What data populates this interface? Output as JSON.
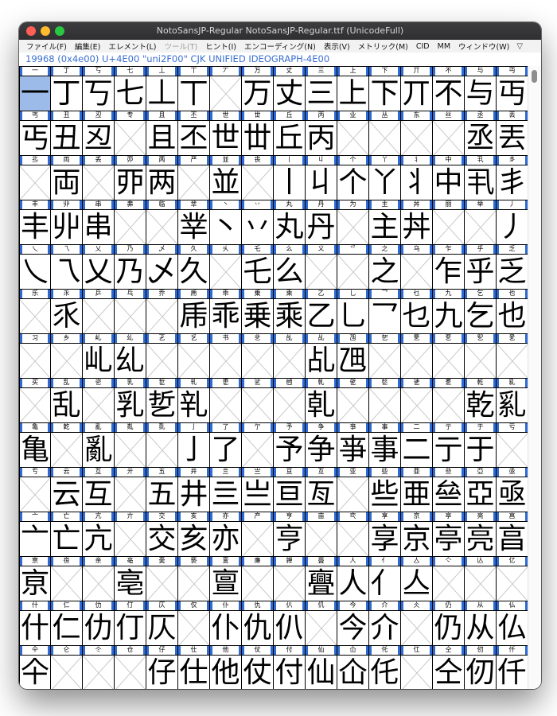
{
  "window": {
    "title": "NotoSansJP-Regular  NotoSansJP-Regular.ttf (UnicodeFull)"
  },
  "menu": [
    {
      "label": "ファイル(F)",
      "disabled": false
    },
    {
      "label": "編集(E)",
      "disabled": false
    },
    {
      "label": "エレメント(L)",
      "disabled": false
    },
    {
      "label": "ツール(T)",
      "disabled": true
    },
    {
      "label": "ヒント(I)",
      "disabled": false
    },
    {
      "label": "エンコーディング(N)",
      "disabled": false
    },
    {
      "label": "表示(V)",
      "disabled": false
    },
    {
      "label": "メトリック(M)",
      "disabled": false
    },
    {
      "label": "CID",
      "disabled": false
    },
    {
      "label": "MM",
      "disabled": false
    },
    {
      "label": "ウィンドウ(W)",
      "disabled": false
    }
  ],
  "menu_arrow": "▽",
  "info": {
    "text": "19968 (0x4e00) U+4E00 \"uni2F00\" CJK UNIFIED IDEOGRAPH-4E00"
  },
  "colors": {
    "selection": "#9cbbe8",
    "label_accent": "#2e6ad1",
    "info_text": "#3b6fd1"
  },
  "selected_index": 0,
  "rows": [
    {
      "labels": "一丁丂七丄丅丆万丈三上下丌不与丏",
      "glyphs": "一丁丂七丄丅　万丈三上下丌不与丏"
    },
    {
      "labels": "丐丑丒专且丕世丗丘丙业丛东丝丞丟",
      "glyphs": "丐丑丒　且丕世丗丘丙　　　　丞丟"
    },
    {
      "labels": "丠両丢丣两严並丧丨丩个丫丬中丮丯",
      "glyphs": "　両　丣两　並　丨丩个丫丬中丮丯"
    },
    {
      "labels": "丰丱串丳临丵丶丷丸丹为主丼丽举丿",
      "glyphs": "丰丱串　　丵丶丷丸丹　主丼　　丿"
    },
    {
      "labels": "乀乁乂乃乄久乆乇么义乊之乌乍乎乏",
      "glyphs": "乀乁乂乃乄久　乇么　　之　乍乎乏"
    },
    {
      "labels": "乐乑乒乓乔乕乖乗乘乙乚乛乜九乞也",
      "glyphs": "　乑　　　乕乖乗乘乙乚乛乜九乞也"
    },
    {
      "labels": "习乡乢乣乤乥书乧乨乩乪乫乬乭乮乯",
      "glyphs": "　　乢乣　　　　　乩乪　　　　　"
    },
    {
      "labels": "买乱乲乳乴乵乶乷乸乹乺乻乼乽乾乿",
      "glyphs": "　乱　乳乴乵　　　乹　　　　乾乿"
    },
    {
      "labels": "亀亁亂亃亄亅了亇予争亊事二亍于亏",
      "glyphs": "亀　亂　　亅了　予争亊事二亍于　"
    },
    {
      "labels": "亐云互亓五井亖亗亘亙亚些亜亝亞亟",
      "glyphs": "　云互　五井亖亗亘亙　些亜亝亞亟"
    },
    {
      "labels": "亠亡亢亣交亥亦产亨亩亪享京亭亮亯",
      "glyphs": "亠亡亢　交亥亦　亨　　享京亭亮亯"
    },
    {
      "labels": "亰亱亲亳亴亵亶亷亸亹人亻亼亽亾亿",
      "glyphs": "亰　　亳　　亶　　亹人亻亼　　　"
    },
    {
      "labels": "什仁仂仃仄仅仆仇仈仉今介仌仍从仏",
      "glyphs": "什仁仂仃仄　仆仇仈　今介　仍从仏"
    },
    {
      "labels": "仐仑仒仓仔仕他仗付仙仚仛仜仝仞仟",
      "glyphs": "仐　　　仔仕他仗付仙仚仛　仝仞仟"
    }
  ]
}
